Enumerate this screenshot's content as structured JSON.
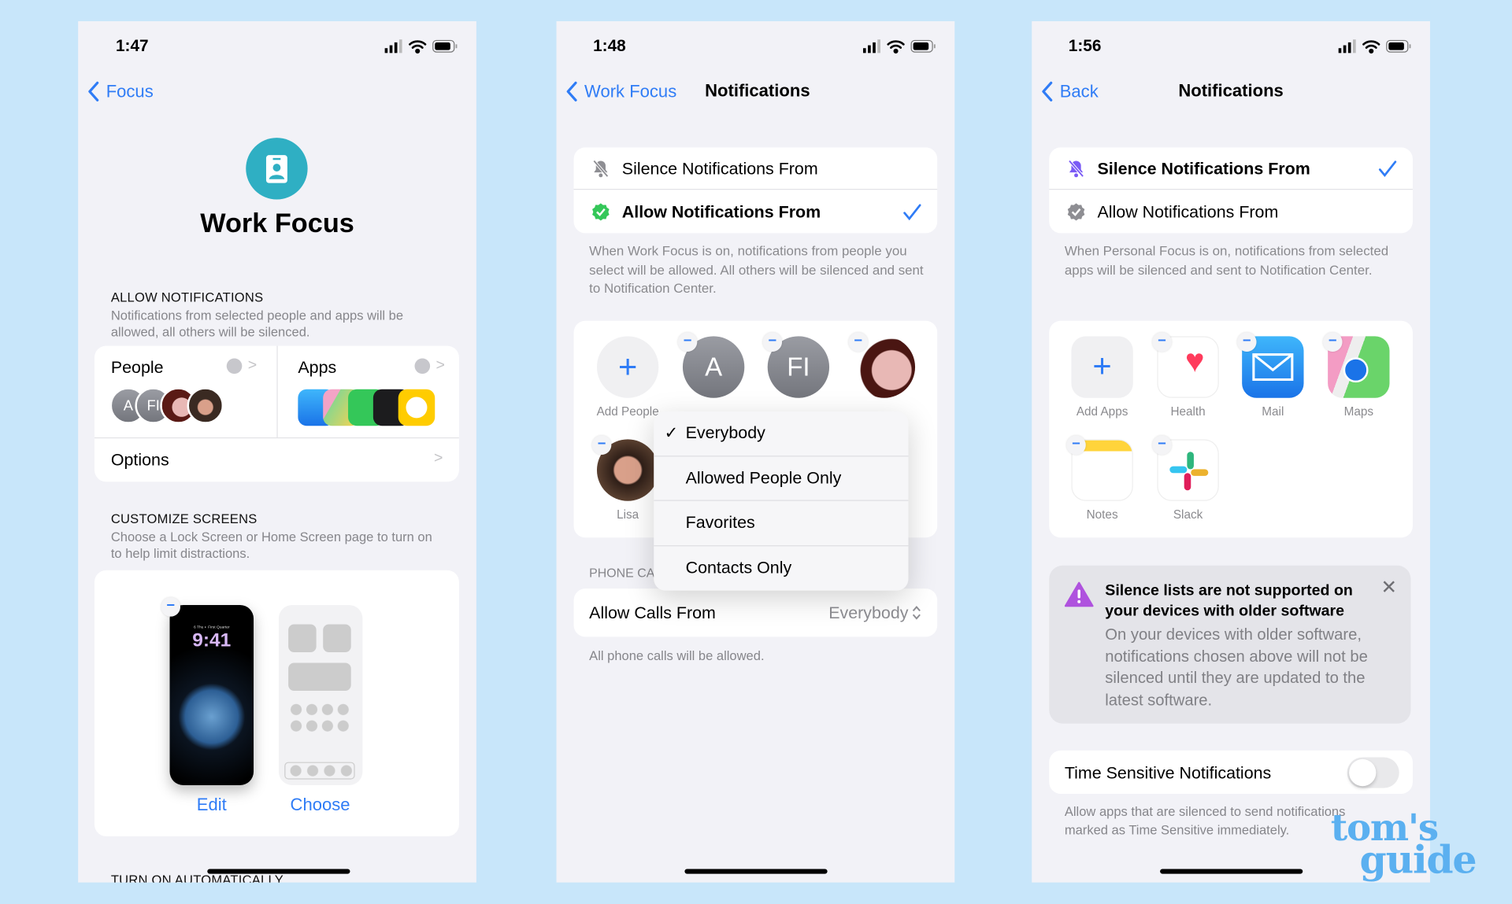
{
  "colors": {
    "background": "#c8e6fa",
    "screen": "#f2f2f7",
    "accent": "#2f7cf6",
    "focus_teal": "#2fafc3",
    "allow_green": "#34c759",
    "warning_purple": "#af52de",
    "watermark": "#5bb0f0"
  },
  "screen1": {
    "time": "1:47",
    "back": "Focus",
    "focus_icon": "id-badge-icon",
    "title": "Work Focus",
    "allow_heading": "ALLOW NOTIFICATIONS",
    "allow_desc": "Notifications from selected people and apps will be allowed, all others will be silenced.",
    "people_label": "People",
    "people_avatars": [
      "A",
      "FI"
    ],
    "apps_label": "Apps",
    "apps_icons": [
      "mail-icon",
      "maps-icon",
      "phone-icon",
      "wallet-icon",
      "clock-icon"
    ],
    "options_label": "Options",
    "customize_heading": "CUSTOMIZE SCREENS",
    "customize_desc": "Choose a Lock Screen or Home Screen page to turn on to help limit distractions.",
    "lock_date": "6 Thu  ◐ First Quarter",
    "lock_time": "9:41",
    "edit": "Edit",
    "choose": "Choose",
    "next_heading": "TURN ON AUTOMATICALLY"
  },
  "screen2": {
    "time": "1:48",
    "back": "Work Focus",
    "title": "Notifications",
    "silence_label": "Silence Notifications From",
    "allow_label": "Allow Notifications From",
    "selected": "allow",
    "desc": "When Work Focus is on, notifications from people you select will be allowed. All others will be silenced and sent to Notification Center.",
    "add_people": "Add People",
    "avatars": [
      "A",
      "FI"
    ],
    "lisa": "Lisa",
    "phone_heading": "PHONE CA",
    "menu": {
      "items": [
        "Everybody",
        "Allowed People Only",
        "Favorites",
        "Contacts Only"
      ],
      "checked": "Everybody"
    },
    "calls_label": "Allow Calls From",
    "calls_value": "Everybody",
    "calls_desc": "All phone calls will be allowed."
  },
  "screen3": {
    "time": "1:56",
    "back": "Back",
    "title": "Notifications",
    "silence_label": "Silence Notifications From",
    "allow_label": "Allow Notifications From",
    "selected": "silence",
    "desc": "When Personal Focus is on, notifications from selected apps will be silenced and sent to Notification Center.",
    "apps": [
      "Add Apps",
      "Health",
      "Mail",
      "Maps",
      "Notes",
      "Slack"
    ],
    "warning_title": "Silence lists are not supported on your devices with older software",
    "warning_body": "On your devices with older software, notifications chosen above will not be silenced until they are updated to the latest software.",
    "time_sensitive_label": "Time Sensitive Notifications",
    "time_sensitive_on": false,
    "time_sensitive_desc": "Allow apps that are silenced to send notifications marked as Time Sensitive immediately."
  },
  "watermark": {
    "line1": "tom's",
    "line2": "guide"
  }
}
